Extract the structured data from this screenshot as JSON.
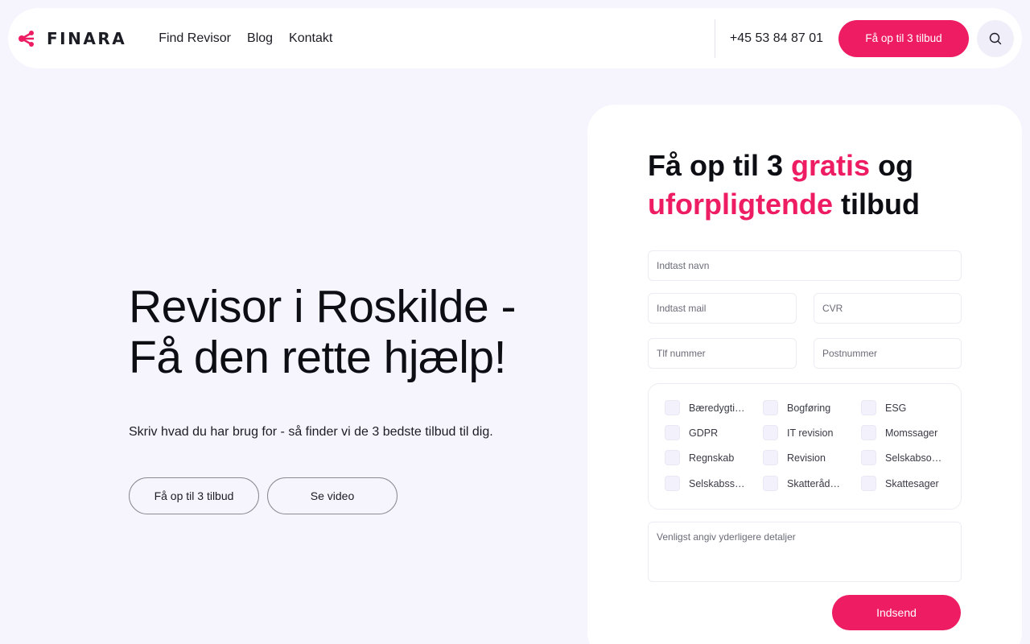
{
  "header": {
    "brand": "FINARA",
    "nav": [
      "Find Revisor",
      "Blog",
      "Kontakt"
    ],
    "phone": "+45 53 84 87 01",
    "cta_label": "Få op til 3 tilbud"
  },
  "hero": {
    "title_line1": "Revisor i Roskilde -",
    "title_line2": "Få den rette hjælp!",
    "subtitle": "Skriv hvad du har brug for - så finder vi de 3 bedste tilbud til dig.",
    "primary_button": "Få op til 3 tilbud",
    "video_button": "Se video"
  },
  "form": {
    "title_part1": "Få op til 3 ",
    "title_accent1": "gratis",
    "title_part2": " og",
    "title_accent2": "uforpligtende",
    "title_part3": " tilbud",
    "name_placeholder": "Indtast navn",
    "mail_placeholder": "Indtast mail",
    "cvr_placeholder": "CVR",
    "phone_placeholder": "Tlf nummer",
    "zip_placeholder": "Postnummer",
    "services": [
      "Bæredygtighed",
      "Bogføring",
      "ESG",
      "GDPR",
      "IT revision",
      "Momssager",
      "Regnskab",
      "Revision",
      "Selskabsomdannelse",
      "Selskabsstiftelse",
      "Skatterådgivning",
      "Skattesager"
    ],
    "details_placeholder": "Venligst angiv yderligere detaljer",
    "submit_label": "Indsend"
  },
  "colors": {
    "accent": "#ee1c62",
    "background": "#f6f4fd"
  },
  "icons": [
    "share-logo-icon",
    "search-icon"
  ]
}
